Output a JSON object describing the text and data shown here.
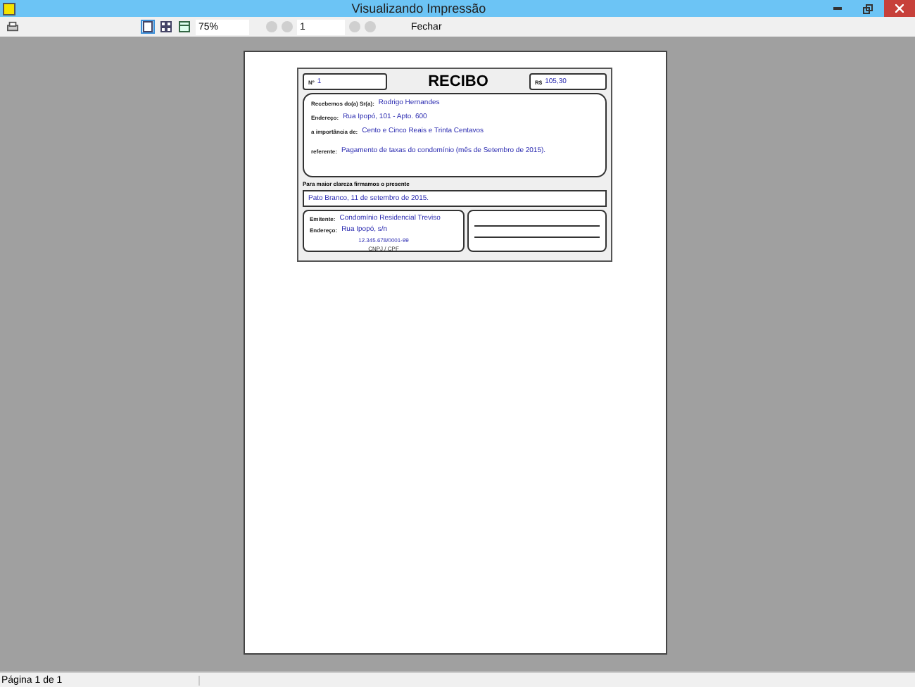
{
  "window": {
    "title": "Visualizando Impressão"
  },
  "toolbar": {
    "view_modes": [
      {
        "selected": true
      },
      {
        "selected": false
      },
      {
        "selected": false
      }
    ],
    "zoom": "75%",
    "navigation_disabled": true,
    "page": "1",
    "close": "Fechar"
  },
  "receipt": {
    "number_label": "Nº",
    "number": "1",
    "title": "RECIBO",
    "amount_label": "R$",
    "amount": "105,30",
    "fields": [
      {
        "label": "Recebemos do(a) Sr(a):",
        "value": "Rodrigo Hernandes"
      },
      {
        "label": "Endereço:",
        "value": "Rua Ipopó, 101 - Apto. 600"
      },
      {
        "label": "a importância de:",
        "value": "Cento e Cinco Reais e Trinta Centavos"
      },
      {
        "label": "referente:",
        "value": "Pagamento de taxas do condomínio (mês de Setembro de 2015)."
      }
    ],
    "clarity_note": "Para maior clareza firmamos o presente",
    "place_date": "Pato Branco, 11 de setembro de 2015.",
    "issuer": {
      "fields": [
        {
          "label": "Emitente:",
          "value": "Condomínio Residencial Treviso"
        },
        {
          "label": "Endereço:",
          "value": "Rua Ipopó, s/n"
        }
      ],
      "document": "12.345.678/0001-99",
      "document_label": "CNPJ / CPF"
    }
  },
  "status_bar": "Página 1 de 1"
}
